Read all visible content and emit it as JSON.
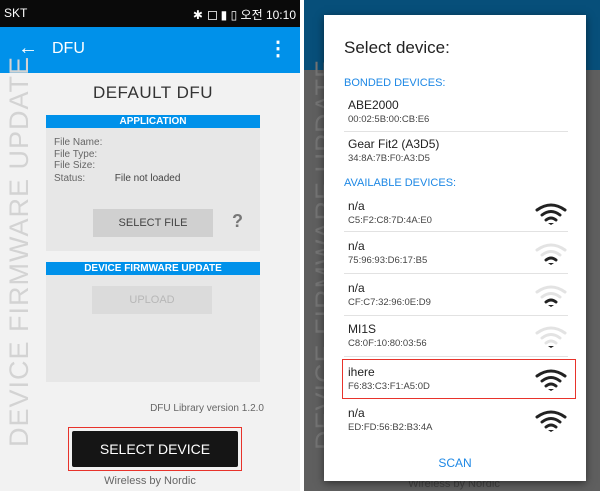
{
  "left": {
    "status": {
      "carrier": "SKT",
      "time": "오전 10:10"
    },
    "appbar": {
      "back": "←",
      "title": "DFU",
      "menu": "⋮"
    },
    "vertical_label": "DEVICE FIRMWARE UPDATE",
    "title": "DEFAULT DFU",
    "application": {
      "header": "APPLICATION",
      "file_name_label": "File Name:",
      "file_type_label": "File Type:",
      "file_size_label": "File Size:",
      "status_label": "Status:",
      "status_value": "File not loaded",
      "select_file": "SELECT FILE",
      "help": "?"
    },
    "dfu": {
      "header": "DEVICE FIRMWARE UPDATE",
      "upload": "UPLOAD"
    },
    "version": "DFU Library version 1.2.0",
    "select_device": "SELECT DEVICE",
    "footer": "Wireless by Nordic"
  },
  "right": {
    "background_label": "DEVICE FIRMWARE UPDATE",
    "background_footer": "Wireless by Nordic",
    "dialog": {
      "title": "Select device:",
      "bonded_label": "BONDED DEVICES:",
      "bonded": [
        {
          "name": "ABE2000",
          "address": "00:02:5B:00:CB:E6"
        },
        {
          "name": "Gear Fit2 (A3D5)",
          "address": "34:8A:7B:F0:A3:D5"
        }
      ],
      "available_label": "AVAILABLE DEVICES:",
      "available": [
        {
          "name": "n/a",
          "address": "C5:F2:C8:7D:4A:E0",
          "signal": 3
        },
        {
          "name": "n/a",
          "address": "75:96:93:D6:17:B5",
          "signal": 1
        },
        {
          "name": "n/a",
          "address": "CF:C7:32:96:0E:D9",
          "signal": 1
        },
        {
          "name": "MI1S",
          "address": "C8:0F:10:80:03:56",
          "signal": 0
        },
        {
          "name": "ihere",
          "address": "F6:83:C3:F1:A5:0D",
          "signal": 3
        },
        {
          "name": "n/a",
          "address": "ED:FD:56:B2:B3:4A",
          "signal": 3
        }
      ],
      "scan": "SCAN"
    }
  },
  "colors": {
    "accent": "#0091ea",
    "link": "#1e88e5",
    "highlight": "#e8332b",
    "signal_on": "#222222",
    "signal_off": "#e3e3e3"
  }
}
